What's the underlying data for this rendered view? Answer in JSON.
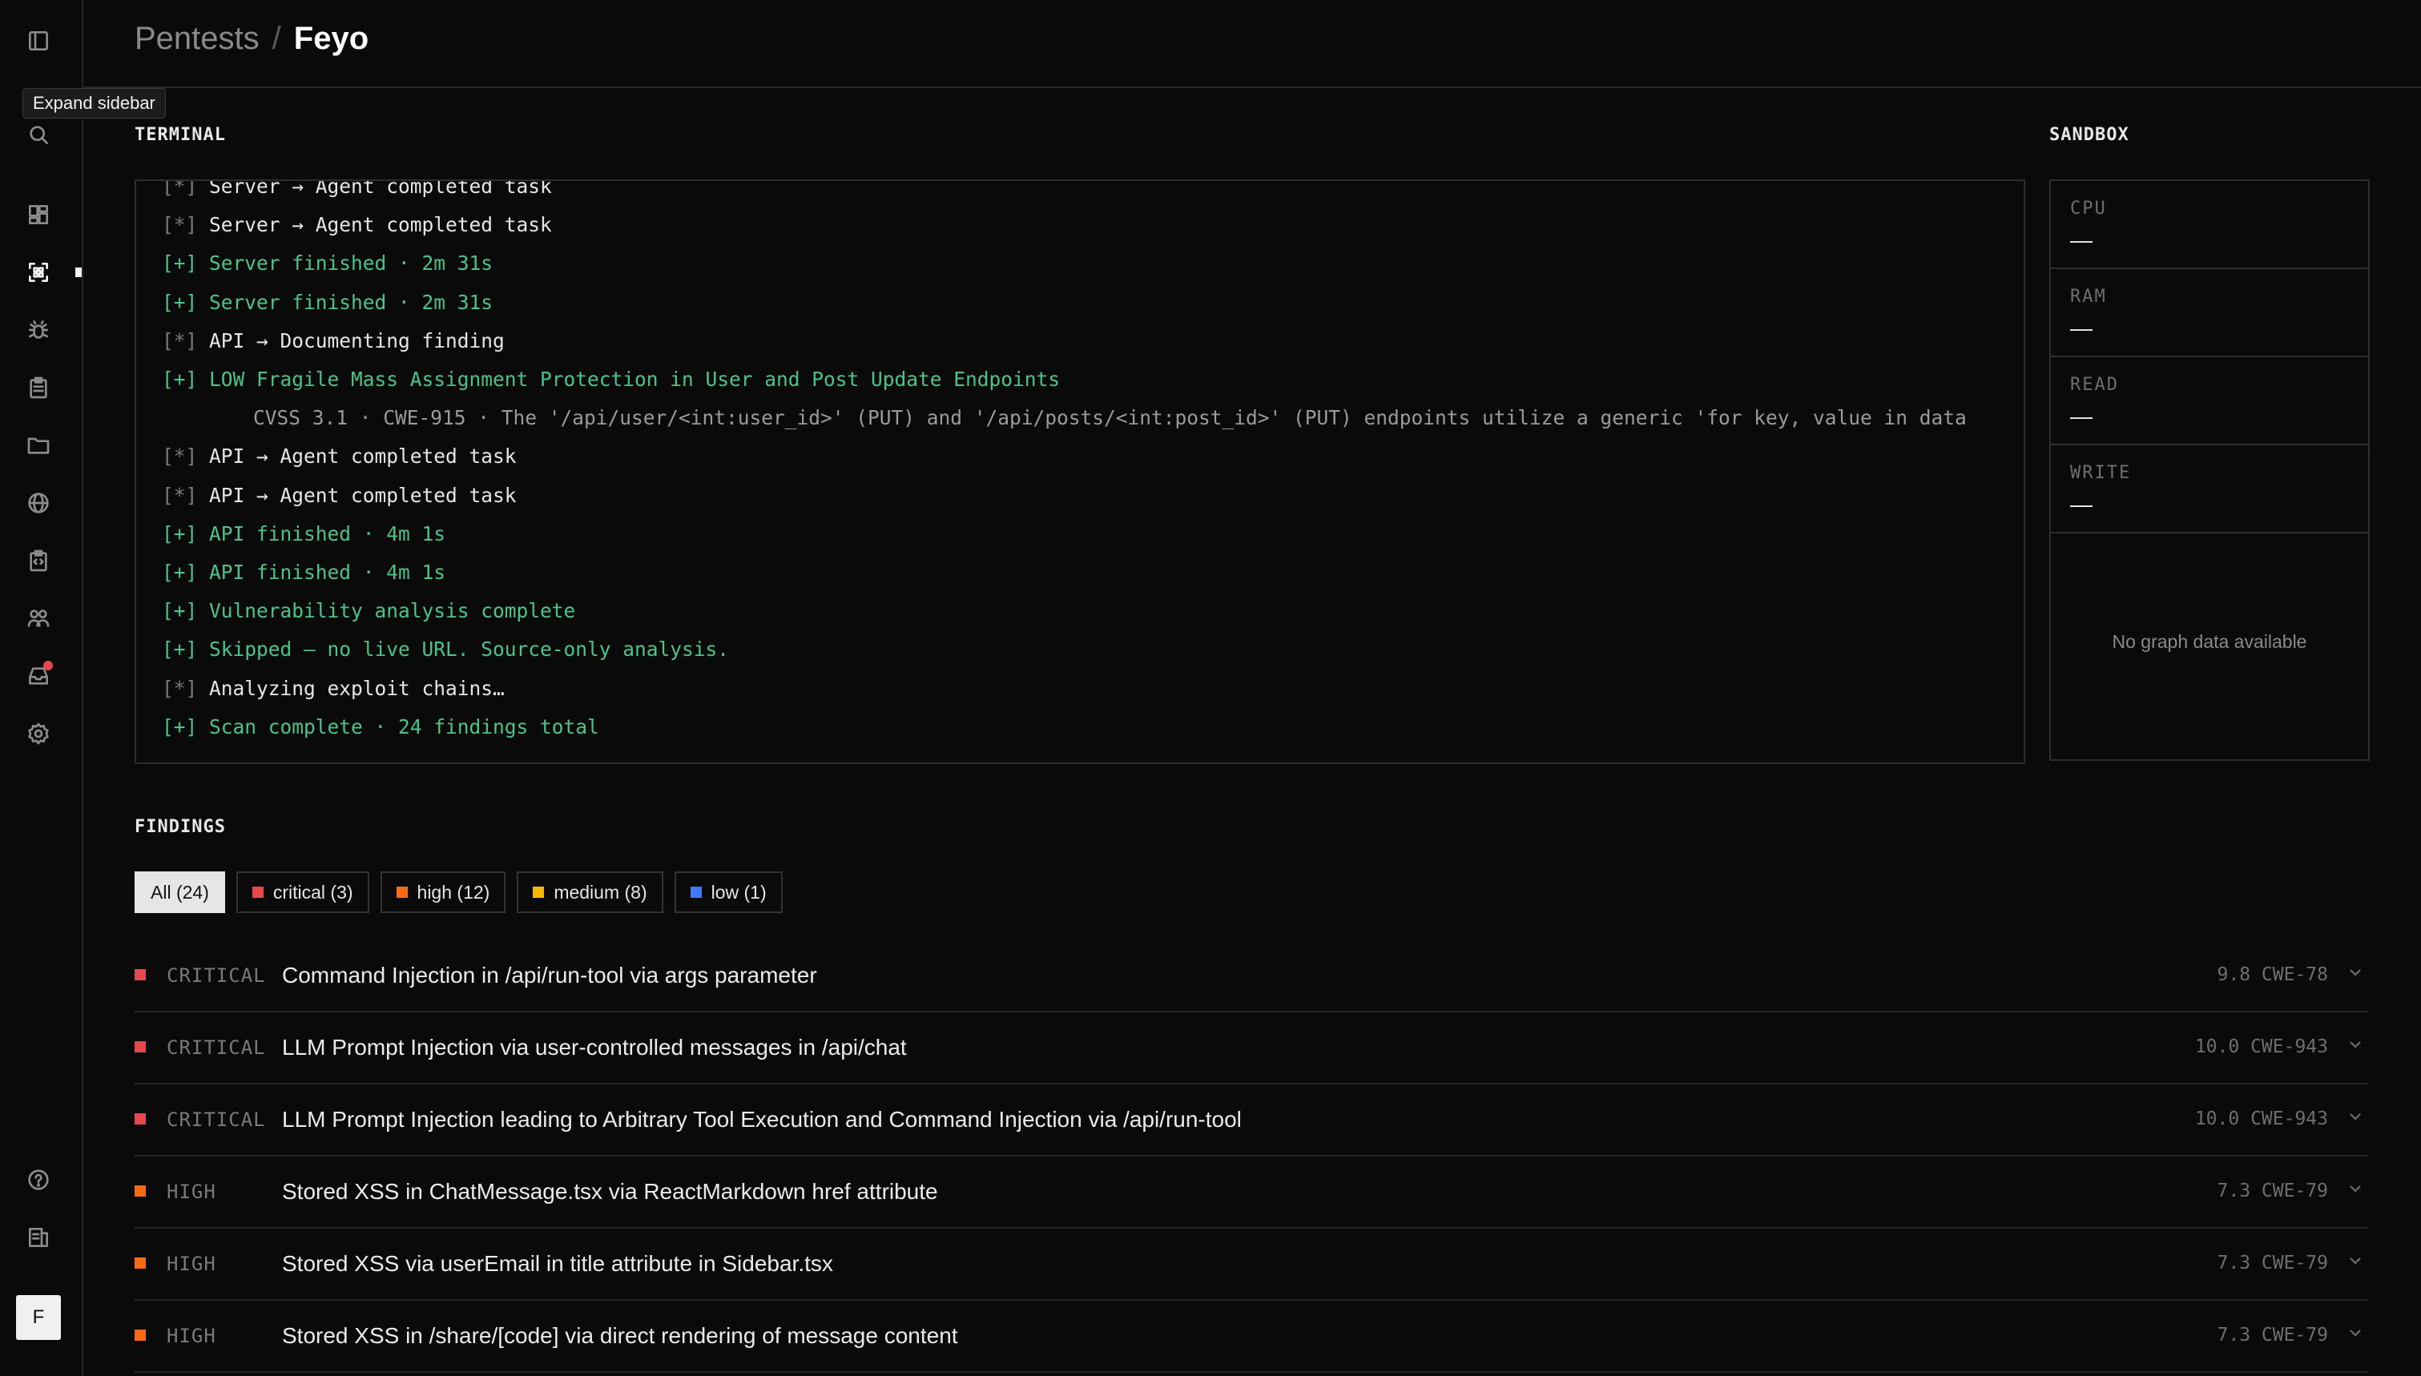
{
  "header": {
    "parent": "Pentests",
    "separator": "/",
    "current": "Feyo"
  },
  "sidebar": {
    "tooltip": "Expand sidebar",
    "avatar_initial": "F",
    "icons": [
      "sidebar-toggle-icon",
      "search-icon",
      "dashboard-icon",
      "scan-icon",
      "bug-icon",
      "clipboard-icon",
      "folder-icon",
      "globe-icon",
      "code-report-icon",
      "team-icon",
      "inbox-icon",
      "settings-icon",
      "help-icon",
      "docs-icon"
    ]
  },
  "terminal": {
    "label": "TERMINAL",
    "lines": [
      {
        "type": "info",
        "prefix": "[*]",
        "text": "Server → Agent completed task"
      },
      {
        "type": "info",
        "prefix": "[*]",
        "text": "Server → Agent completed task"
      },
      {
        "type": "ok",
        "text": "[+] Server finished · 2m 31s"
      },
      {
        "type": "ok",
        "text": "[+] Server finished · 2m 31s"
      },
      {
        "type": "info",
        "prefix": "[*]",
        "text": "API → Documenting finding"
      },
      {
        "type": "ok",
        "text": "[+] LOW  Fragile Mass Assignment Protection in User and Post Update Endpoints"
      },
      {
        "type": "detail",
        "text": "CVSS 3.1 · CWE-915 · The '/api/user/<int:user_id>' (PUT) and '/api/posts/<int:post_id>' (PUT) endpoints utilize a generic 'for key, value in data"
      },
      {
        "type": "info",
        "prefix": "[*]",
        "text": "API → Agent completed task"
      },
      {
        "type": "info",
        "prefix": "[*]",
        "text": "API → Agent completed task"
      },
      {
        "type": "ok",
        "text": "[+] API finished · 4m 1s"
      },
      {
        "type": "ok",
        "text": "[+] API finished · 4m 1s"
      },
      {
        "type": "ok",
        "text": "[+] Vulnerability analysis complete"
      },
      {
        "type": "ok",
        "text": "[+] Skipped — no live URL. Source-only analysis."
      },
      {
        "type": "info",
        "prefix": "[*]",
        "text": "Analyzing exploit chains…"
      },
      {
        "type": "ok",
        "text": "[+] Scan complete · 24 findings total"
      }
    ]
  },
  "sandbox": {
    "label": "SANDBOX",
    "metrics": [
      {
        "label": "CPU",
        "value": "—"
      },
      {
        "label": "RAM",
        "value": "—"
      },
      {
        "label": "READ",
        "value": "—"
      },
      {
        "label": "WRITE",
        "value": "—"
      }
    ],
    "empty_text": "No graph data available"
  },
  "findings": {
    "label": "FINDINGS",
    "filters": [
      {
        "label": "All (24)",
        "selected": true
      },
      {
        "label": "critical (3)",
        "color": "#e5484d"
      },
      {
        "label": "high (12)",
        "color": "#f76b15"
      },
      {
        "label": "medium (8)",
        "color": "#f5b800"
      },
      {
        "label": "low (1)",
        "color": "#3e7bfa"
      }
    ],
    "items": [
      {
        "severity": "CRITICAL",
        "color": "#e5484d",
        "title": "Command Injection in /api/run-tool via args parameter",
        "score": "9.8",
        "cwe": "CWE-78"
      },
      {
        "severity": "CRITICAL",
        "color": "#e5484d",
        "title": "LLM Prompt Injection via user-controlled messages in /api/chat",
        "score": "10.0",
        "cwe": "CWE-943"
      },
      {
        "severity": "CRITICAL",
        "color": "#e5484d",
        "title": "LLM Prompt Injection leading to Arbitrary Tool Execution and Command Injection via /api/run-tool",
        "score": "10.0",
        "cwe": "CWE-943"
      },
      {
        "severity": "HIGH",
        "color": "#f76b15",
        "title": "Stored XSS in ChatMessage.tsx via ReactMarkdown href attribute",
        "score": "7.3",
        "cwe": "CWE-79"
      },
      {
        "severity": "HIGH",
        "color": "#f76b15",
        "title": "Stored XSS via userEmail in title attribute in Sidebar.tsx",
        "score": "7.3",
        "cwe": "CWE-79"
      },
      {
        "severity": "HIGH",
        "color": "#f76b15",
        "title": "Stored XSS in /share/[code] via direct rendering of message content",
        "score": "7.3",
        "cwe": "CWE-79"
      }
    ]
  }
}
